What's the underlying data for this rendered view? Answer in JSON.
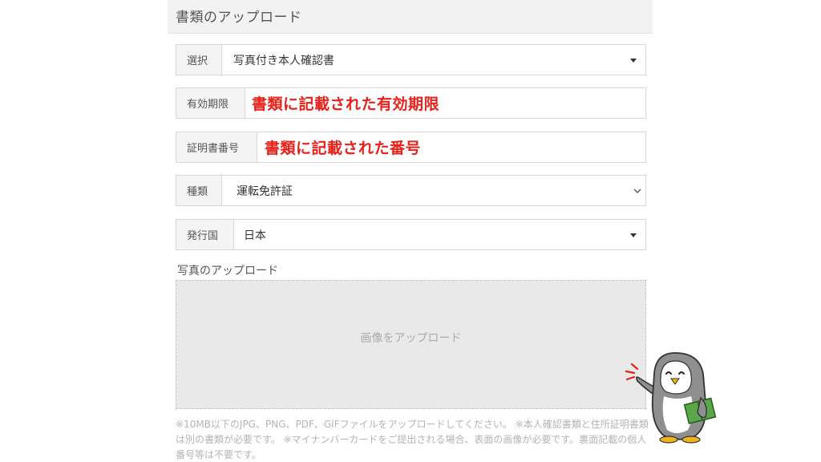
{
  "header": {
    "title": "書類のアップロード"
  },
  "form": {
    "select_row": {
      "label": "選択",
      "value": "写真付き本人確認書"
    },
    "expiry_row": {
      "label": "有効期限",
      "annotation": "書類に記載された有効期限"
    },
    "number_row": {
      "label": "証明書番号",
      "annotation": "書類に記載された番号"
    },
    "type_row": {
      "label": "種類",
      "value": "運転免許証"
    },
    "country_row": {
      "label": "発行国",
      "value": "日本"
    }
  },
  "upload": {
    "section_title": "写真のアップロード",
    "dropzone_label": "画像をアップロード",
    "note": "※10MB以下のJPG、PNG、PDF、GIFファイルをアップロードしてください。 ※本人確認書類と住所証明書類は別の書類が必要です。 ※マイナンバーカードをご提出される場合、表面の画像が必要です。裏面記載の個人番号等は不要です。"
  },
  "colors": {
    "annotation": "#e8211a",
    "header_bg": "#f2f2f2",
    "label_bg": "#f4f4f4",
    "dropzone_bg": "#e9e9e9",
    "mascot_book": "#5aa64a"
  }
}
